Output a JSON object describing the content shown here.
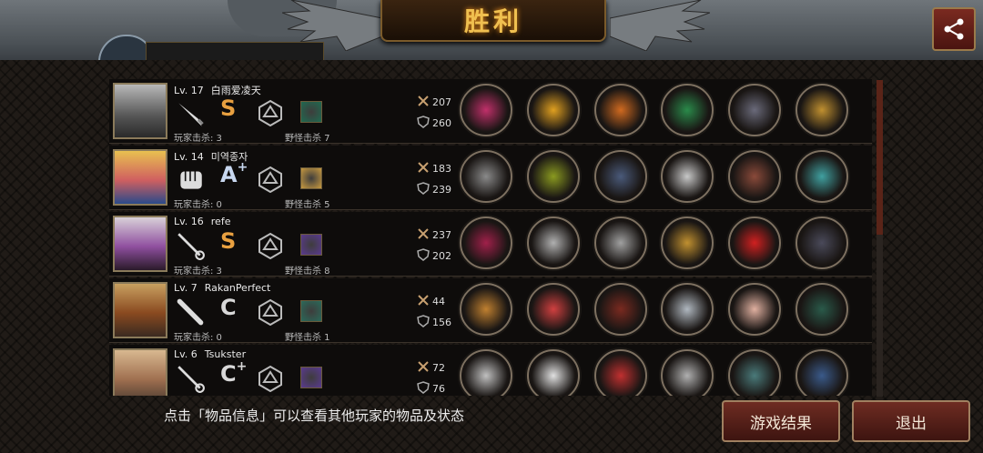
{
  "header": {
    "title": "胜利"
  },
  "players": [
    {
      "level": "Lv. 17",
      "name": "白雨爱凌天",
      "grade": "S",
      "grade_plus": "",
      "kills": "玩家击杀: 3",
      "monster_kills": "野怪击杀 7",
      "attack": "207",
      "defense": "260",
      "weapon_icon": "dagger-icon",
      "pet_color": "#1f6a50"
    },
    {
      "level": "Lv. 14",
      "name": "미역종자",
      "grade": "A",
      "grade_plus": "+",
      "kills": "玩家击杀: 0",
      "monster_kills": "野怪击杀 5",
      "attack": "183",
      "defense": "239",
      "weapon_icon": "fist-icon",
      "pet_color": "#c89a40"
    },
    {
      "level": "Lv. 16",
      "name": "refe",
      "grade": "S",
      "grade_plus": "",
      "kills": "玩家击杀: 3",
      "monster_kills": "野怪击杀 8",
      "attack": "237",
      "defense": "202",
      "weapon_icon": "rapier-icon",
      "pet_color": "#5a3a90"
    },
    {
      "level": "Lv. 7",
      "name": "RakanPerfect",
      "grade": "C",
      "grade_plus": "",
      "kills": "玩家击杀: 0",
      "monster_kills": "野怪击杀 1",
      "attack": "44",
      "defense": "156",
      "weapon_icon": "bat-icon",
      "pet_color": "#2a6a5a"
    },
    {
      "level": "Lv. 6",
      "name": "Tsukster",
      "grade": "C",
      "grade_plus": "+",
      "kills": "",
      "monster_kills": "",
      "attack": "72",
      "defense": "76",
      "weapon_icon": "rapier-icon",
      "pet_color": "#5a3a90"
    }
  ],
  "colors": {
    "grade_S": "#e8a040",
    "grade_A": "#c8d8f0",
    "grade_C": "#d8d8d8",
    "accent": "#f0c050"
  },
  "footer": {
    "hint": "点击「物品信息」可以查看其他玩家的物品及状态",
    "result_button": "游戏结果",
    "exit_button": "退出"
  }
}
